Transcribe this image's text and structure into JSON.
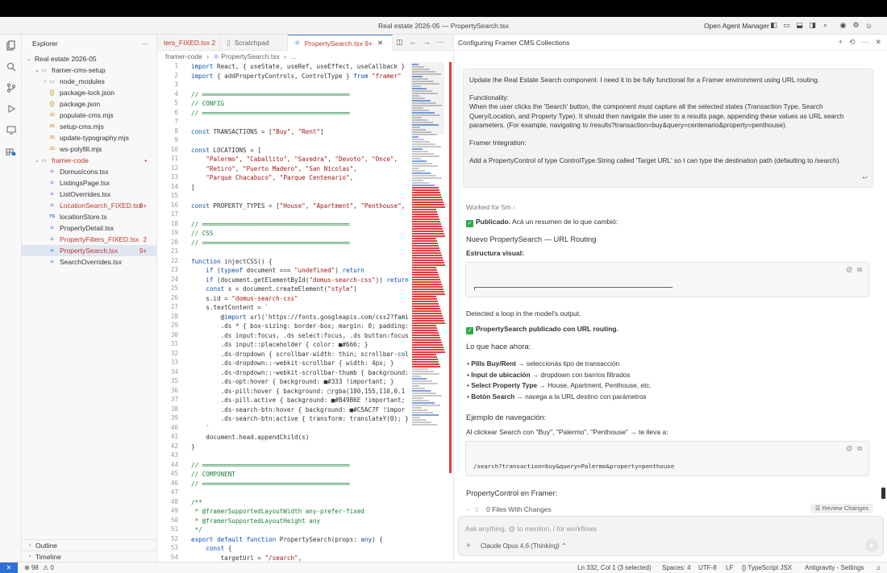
{
  "window": {
    "title": "Real estate 2026-05 — PropertySearch.tsx",
    "agent_manager": "Open Agent Manager"
  },
  "explorer": {
    "title": "Explorer",
    "root": "Real estate 2026-05",
    "items": [
      {
        "label": "framer-cms-setup",
        "kind": "folder-open",
        "depth": 1
      },
      {
        "label": "node_modules",
        "kind": "folder",
        "depth": 2
      },
      {
        "label": "package-lock.json",
        "kind": "json",
        "depth": 2
      },
      {
        "label": "package.json",
        "kind": "json",
        "depth": 2
      },
      {
        "label": "populate-cms.mjs",
        "kind": "js",
        "depth": 2
      },
      {
        "label": "setup-cms.mjs",
        "kind": "js",
        "depth": 2
      },
      {
        "label": "update-typography.mjs",
        "kind": "js",
        "depth": 2
      },
      {
        "label": "ws-polyfill.mjs",
        "kind": "js",
        "depth": 2
      },
      {
        "label": "framer-code",
        "kind": "folder-open",
        "depth": 1,
        "badge": "•",
        "error": true
      },
      {
        "label": "DomusIcons.tsx",
        "kind": "react",
        "depth": 2
      },
      {
        "label": "ListingsPage.tsx",
        "kind": "react",
        "depth": 2
      },
      {
        "label": "ListOverrides.tsx",
        "kind": "react",
        "depth": 2
      },
      {
        "label": "LocationSearch_FIXED.tsx",
        "kind": "react",
        "depth": 2,
        "badge": "9+",
        "error": true
      },
      {
        "label": "locationStore.ts",
        "kind": "ts",
        "depth": 2
      },
      {
        "label": "PropertyDetail.tsx",
        "kind": "react",
        "depth": 2
      },
      {
        "label": "PropertyFilters_FIXED.tsx",
        "kind": "react",
        "depth": 2,
        "badge": "2",
        "error": true
      },
      {
        "label": "PropertySearch.tsx",
        "kind": "react",
        "depth": 2,
        "badge": "9+",
        "error": true,
        "selected": true
      },
      {
        "label": "SearchOverrides.tsx",
        "kind": "react",
        "depth": 2
      }
    ],
    "outline": "Outline",
    "timeline": "Timeline"
  },
  "tabs": [
    {
      "label": "ters_FIXED.tsx 2",
      "error": true
    },
    {
      "label": "Scratchpad"
    },
    {
      "label": "PropertySearch.tsx 9+",
      "active": true,
      "error": true
    }
  ],
  "breadcrumb": [
    "framer-code",
    "PropertySearch.tsx",
    "..."
  ],
  "code": {
    "start_line": 1,
    "lines": [
      "import React, { useState, useRef, useEffect, useCallback }",
      "import { addPropertyControls, ControlType } from \"framer\"",
      "",
      "// ════════════════════════════════════════",
      "// CONFIG",
      "// ════════════════════════════════════════",
      "",
      "const TRANSACTIONS = [\"Buy\", \"Rent\"]",
      "",
      "const LOCATIONS = [",
      "    \"Palermo\", \"Caballito\", \"Savedra\", \"Devoto\", \"Once\",",
      "    \"Retiro\", \"Puerto Madero\", \"San Nicolas\",",
      "    \"Parque Chacabuco\", \"Parque Centenario\",",
      "]",
      "",
      "const PROPERTY_TYPES = [\"House\", \"Apartment\", \"Penthouse\",",
      "",
      "// ════════════════════════════════════════",
      "// CSS",
      "// ════════════════════════════════════════",
      "",
      "function injectCSS() {",
      "    if (typeof document === \"undefined\") return",
      "    if (document.getElementById(\"domus-search-css\")) return",
      "    const s = document.createElement(\"style\")",
      "    s.id = \"domus-search-css\"",
      "    s.textContent = `",
      "        @import url('https://fonts.googleapis.com/css2?fami",
      "        .ds * { box-sizing: border-box; margin: 0; padding:",
      "        .ds input:focus, .ds select:focus, .ds button:focus",
      "        .ds input::placeholder { color: ■#666; }",
      "        .ds-dropdown { scrollbar-width: thin; scrollbar-col",
      "        .ds-dropdown::-webkit-scrollbar { width: 4px; }",
      "        .ds-dropdown::-webkit-scrollbar-thumb { background:",
      "        .ds-opt:hover { background: ■#333 !important; }",
      "        .ds-pill:hover { background: □rgba(180,155,110,0.1",
      "        .ds-pill.active { background: ■#B49B6E !important;",
      "        .ds-search-btn:hover { background: ■#C5AC7F !impor",
      "        .ds-search-btn:active { transform: translateY(0); }",
      "    `",
      "    document.head.appendChild(s)",
      "}",
      "",
      "// ════════════════════════════════════════",
      "// COMPONENT",
      "// ════════════════════════════════════════",
      "",
      "/**",
      " * @framerSupportedLayoutWidth any-prefer-fixed",
      " * @framerSupportedLayoutHeight any",
      " */",
      "export default function PropertySearch(props: any) {",
      "    const {",
      "        targetUrl = \"/search\","
    ]
  },
  "chat": {
    "title": "Configuring Framer CMS Collections",
    "prompt": [
      "Update the Real Estate Search component. I need it to be fully functional for a Framer environment using URL routing.",
      "Functionality:\nWhen the user clicks the 'Search' button, the component must capture all the selected states (Transaction Type, Search Query/Location, and Property Type). It should then navigate the user to a results page, appending these values as URL search parameters. (For example, navigating to /results?transaction=buy&query=centenario&property=penthouse).",
      "Framer Integration:",
      "Add a PropertyControl of type ControlType.String called 'Target URL' so I can type the destination path (defaulting to /search)."
    ],
    "worked": "Worked for 5m",
    "published_strong": "Publicado.",
    "published_rest": " Acá un resumen de lo que cambió:",
    "heading1": "Nuevo PropertySearch — URL Routing",
    "visual_label": "Estructura visual:",
    "loop_text": "Detected a loop in the model's output.",
    "published2": "PropertySearch publicado con URL routing.",
    "what_label": "Lo que hace ahora:",
    "bullets": [
      {
        "strong": "Pills Buy/Rent",
        "rest": " → seleccionás tipo de transacción"
      },
      {
        "strong": "Input de ubicación",
        "rest": " → dropdown con barrios filtrados"
      },
      {
        "strong": "Select Property Type",
        "rest": " → House, Apartment, Penthouse, etc."
      },
      {
        "strong": "Botón Search",
        "rest": " → navega a la URL destino con parámetros"
      }
    ],
    "example_heading": "Ejemplo de navegación:",
    "example_text": "Al clickear Search con \"Buy\", \"Palermo\", \"Penthouse\" → te lleva a:",
    "example_code": "/search?transaction=buy&query=Palermo&property=penthouse",
    "property_control": "PropertyControl en Framer:",
    "files_changes": "0 Files With Changes",
    "review": "Review Changes",
    "input_placeholder": "Ask anything, @ to mention, / for workflows",
    "model": "Claude Opus 4.6 (Thinking)"
  },
  "status": {
    "errors": "98",
    "warnings": "0",
    "position": "Ln 332, Col 1 (3 selected)",
    "spaces": "Spaces: 4",
    "encoding": "UTF-8",
    "eol": "LF",
    "language": "TypeScript JSX",
    "account": "Antigravity - Settings"
  },
  "colors": {
    "accent": "#2f6fd7",
    "error": "#e23c3c",
    "success": "#2fa84f"
  }
}
